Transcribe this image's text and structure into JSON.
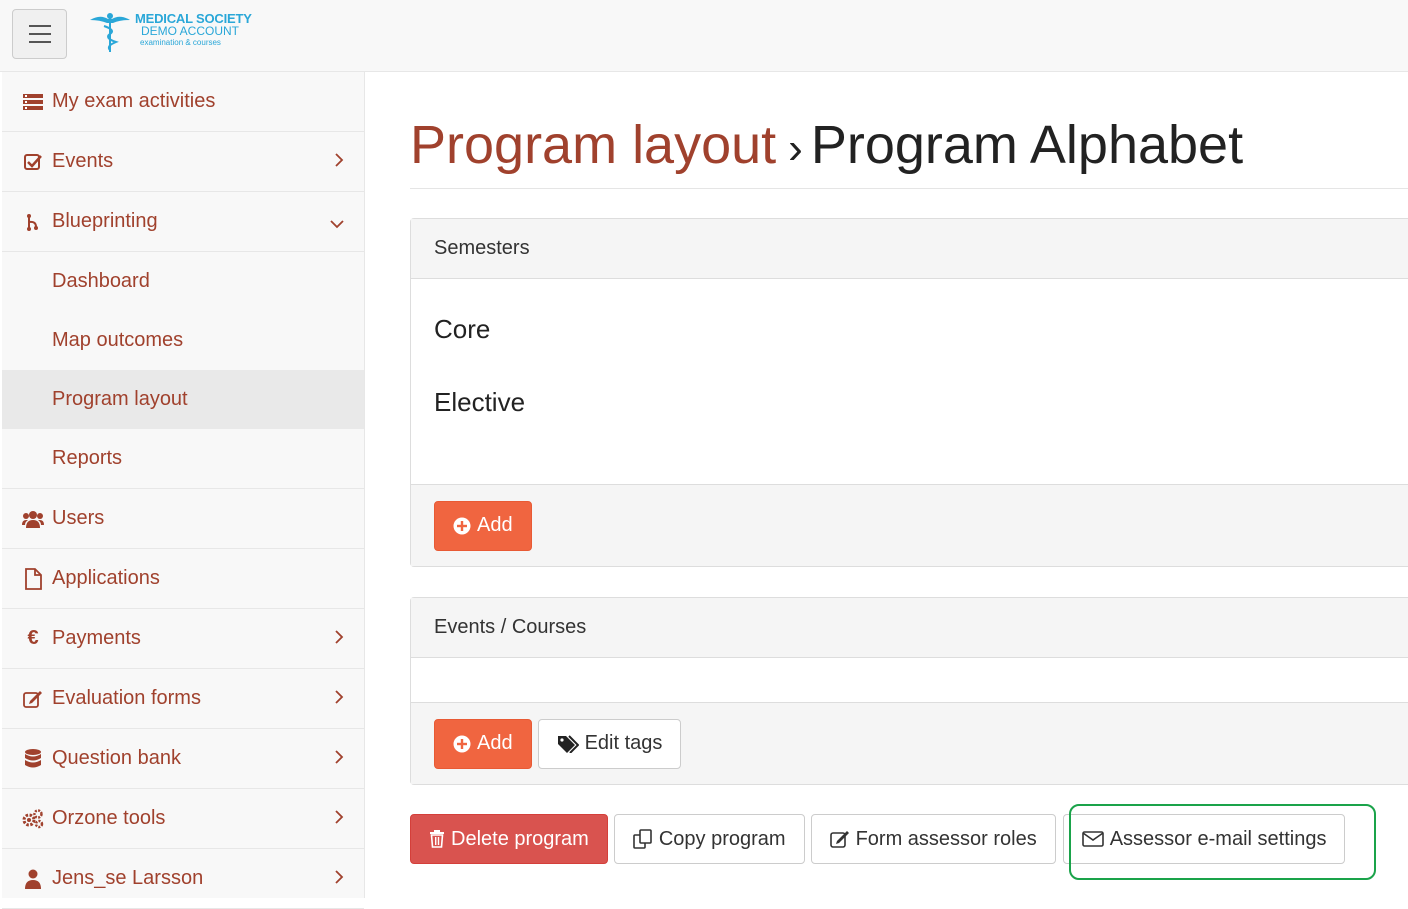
{
  "topbar": {
    "logo": {
      "line1": "MEDICAL SOCIETY",
      "line2": "DEMO ACCOUNT",
      "line3": "examination & courses"
    }
  },
  "sidebar": {
    "items": [
      {
        "label": "My exam activities",
        "icon": "list-icon"
      },
      {
        "label": "Events",
        "icon": "check-square-icon",
        "chevron": "right"
      },
      {
        "label": "Blueprinting",
        "icon": "sitemap-icon",
        "chevron": "down"
      },
      {
        "label": "Dashboard"
      },
      {
        "label": "Map outcomes"
      },
      {
        "label": "Program layout",
        "active": true
      },
      {
        "label": "Reports"
      },
      {
        "label": "Users",
        "icon": "users-icon"
      },
      {
        "label": "Applications",
        "icon": "file-icon"
      },
      {
        "label": "Payments",
        "icon": "euro-icon",
        "chevron": "right"
      },
      {
        "label": "Evaluation forms",
        "icon": "edit-icon",
        "chevron": "right"
      },
      {
        "label": "Question bank",
        "icon": "database-icon",
        "chevron": "right"
      },
      {
        "label": "Orzone tools",
        "icon": "cogs-icon",
        "chevron": "right"
      },
      {
        "label": "Jens_se Larsson",
        "icon": "user-icon",
        "chevron": "right"
      }
    ]
  },
  "page": {
    "breadcrumb": "Program layout",
    "separator": "›",
    "title": "Program Alphabet"
  },
  "semesters": {
    "heading": "Semesters",
    "items": [
      "Core",
      "Elective"
    ],
    "add_label": "Add"
  },
  "events_courses": {
    "heading": "Events / Courses",
    "add_label": "Add",
    "edit_tags_label": "Edit tags"
  },
  "actions": {
    "delete_label": "Delete program",
    "copy_label": "Copy program",
    "roles_label": "Form assessor roles",
    "email_label": "Assessor e-mail settings"
  },
  "colors": {
    "link": "#a0412d",
    "orange": "#f06540",
    "danger": "#d9534f",
    "highlight": "#1aa34a"
  }
}
